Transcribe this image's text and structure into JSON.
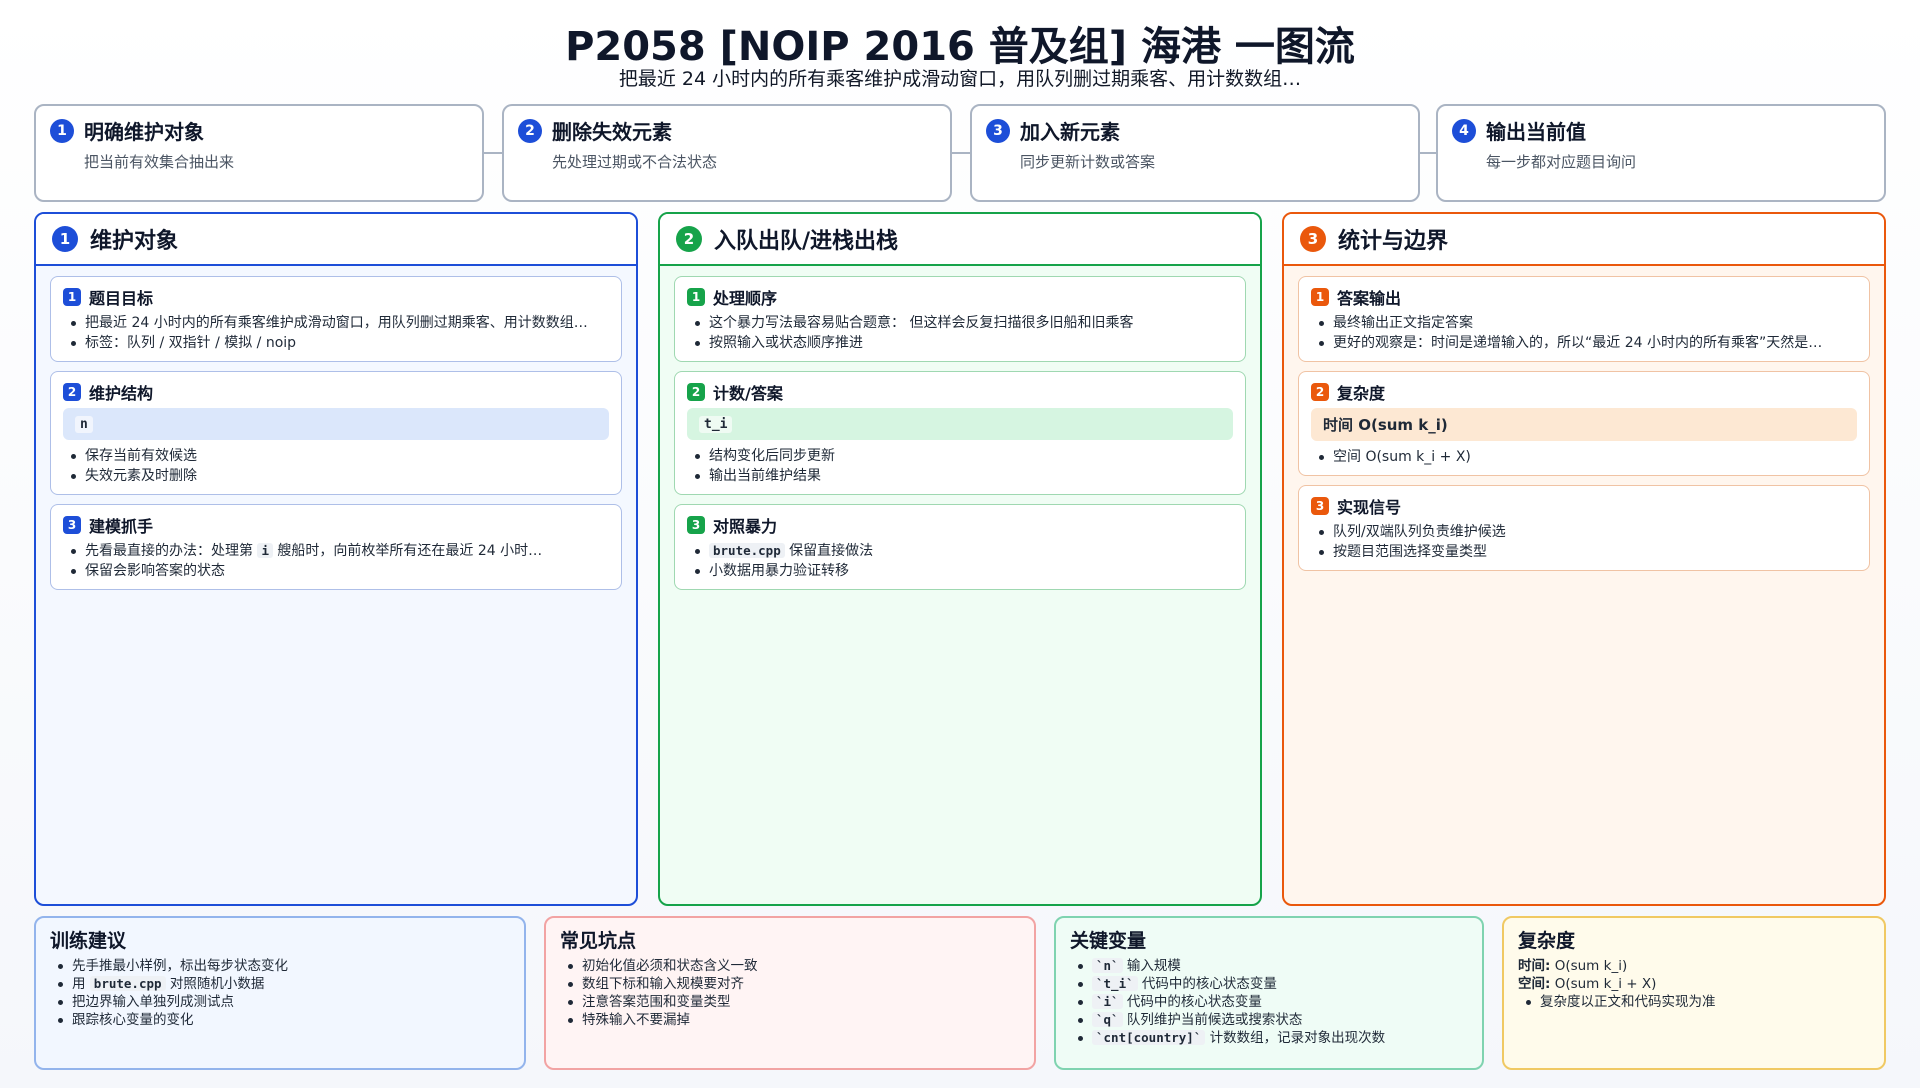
{
  "title": "P2058 [NOIP 2016 普及组] 海港 一图流",
  "subtitle": "把最近 24 小时内的所有乘客维护成滑动窗口，用队列删过期乘客、用计数数组…",
  "steps": [
    {
      "num": "1",
      "title": "明确维护对象",
      "desc": "把当前有效集合抽出来"
    },
    {
      "num": "2",
      "title": "删除失效元素",
      "desc": "先处理过期或不合法状态"
    },
    {
      "num": "3",
      "title": "加入新元素",
      "desc": "同步更新计数或答案"
    },
    {
      "num": "4",
      "title": "输出当前值",
      "desc": "每一步都对应题目询问"
    }
  ],
  "columns": {
    "col1": {
      "num": "1",
      "title": "维护对象",
      "card1": {
        "num": "1",
        "title": "题目目标",
        "items": [
          "把最近 24 小时内的所有乘客维护成滑动窗口，用队列删过期乘客、用计数数组…",
          "标签：队列 / 双指针 / 模拟 / noip"
        ]
      },
      "card2": {
        "num": "2",
        "title": "维护结构",
        "highlight": "n",
        "items": [
          "保存当前有效候选",
          "失效元素及时删除"
        ]
      },
      "card3": {
        "num": "3",
        "title": "建模抓手",
        "item1_pre": "先看最直接的办法：处理第 ",
        "item1_code": "i",
        "item1_post": " 艘船时，向前枚举所有还在最近 24 小时…",
        "item2": "保留会影响答案的状态"
      }
    },
    "col2": {
      "num": "2",
      "title": "入队出队/进栈出栈",
      "card1": {
        "num": "1",
        "title": "处理顺序",
        "items": [
          "这个暴力写法最容易贴合题意： 但这样会反复扫描很多旧船和旧乘客",
          "按照输入或状态顺序推进"
        ]
      },
      "card2": {
        "num": "2",
        "title": "计数/答案",
        "highlight": "t_i",
        "items": [
          "结构变化后同步更新",
          "输出当前维护结果"
        ]
      },
      "card3": {
        "num": "3",
        "title": "对照暴力",
        "item1_code": "brute.cpp",
        "item1_post": " 保留直接做法",
        "item2": "小数据用暴力验证转移"
      }
    },
    "col3": {
      "num": "3",
      "title": "统计与边界",
      "card1": {
        "num": "1",
        "title": "答案输出",
        "items": [
          "最终输出正文指定答案",
          "更好的观察是：时间是递增输入的，所以“最近 24 小时内的所有乘客”天然是…"
        ]
      },
      "card2": {
        "num": "2",
        "title": "复杂度",
        "highlight": "时间 O(sum k_i)",
        "items": [
          "空间 O(sum k_i + X)"
        ]
      },
      "card3": {
        "num": "3",
        "title": "实现信号",
        "items": [
          "队列/双端队列负责维护候选",
          "按题目范围选择变量类型"
        ]
      }
    }
  },
  "bottom": {
    "training": {
      "title": "训练建议",
      "item1": "先手推最小样例，标出每步状态变化",
      "item2_pre": "用 ",
      "item2_code": "brute.cpp",
      "item2_post": " 对照随机小数据",
      "item3": "把边界输入单独列成测试点",
      "item4": "跟踪核心变量的变化"
    },
    "pitfalls": {
      "title": "常见坑点",
      "items": [
        "初始化值必须和状态含义一致",
        "数组下标和输入规模要对齐",
        "注意答案范围和变量类型",
        "特殊输入不要漏掉"
      ]
    },
    "vars": {
      "title": "关键变量",
      "items": [
        {
          "code": "`n`",
          "desc": " 输入规模"
        },
        {
          "code": "`t_i`",
          "desc": " 代码中的核心状态变量"
        },
        {
          "code": "`i`",
          "desc": " 代码中的核心状态变量"
        },
        {
          "code": "`q`",
          "desc": " 队列维护当前候选或搜索状态"
        },
        {
          "code": "`cnt[country]`",
          "desc": " 计数数组，记录对象出现次数"
        }
      ]
    },
    "complexity": {
      "title": "复杂度",
      "time_label": "时间:",
      "time_value": " O(sum k_i)",
      "space_label": "空间:",
      "space_value": " O(sum k_i + X)",
      "note": "复杂度以正文和代码实现为准"
    }
  }
}
